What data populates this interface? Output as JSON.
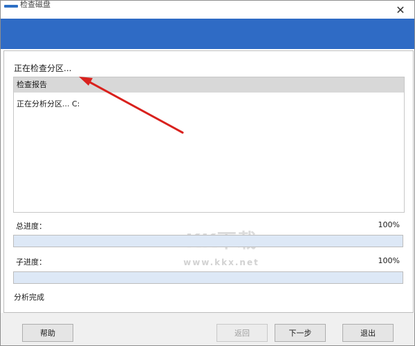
{
  "window": {
    "title": "检查磁盘"
  },
  "status": {
    "heading": "正在检查分区..."
  },
  "report": {
    "header": "检查报告",
    "lines": [
      "正在分析分区... C:"
    ]
  },
  "progress": {
    "total_label": "总进度：",
    "total_percent_text": "100%",
    "total_fraction": 1.0,
    "sub_label": "子进度：",
    "sub_percent_text": "100%",
    "sub_fraction": 1.0
  },
  "result": {
    "text": "分析完成"
  },
  "buttons": {
    "help": "帮助",
    "back": "返回",
    "next": "下一步",
    "exit": "退出"
  },
  "watermark": {
    "main": "KK下载",
    "sub": "www.kkx.net"
  },
  "colors": {
    "banner": "#2f6bc5",
    "progress_fill": "#dde8f6",
    "arrow": "#d9211d"
  },
  "icons": {
    "close": "close-icon"
  }
}
